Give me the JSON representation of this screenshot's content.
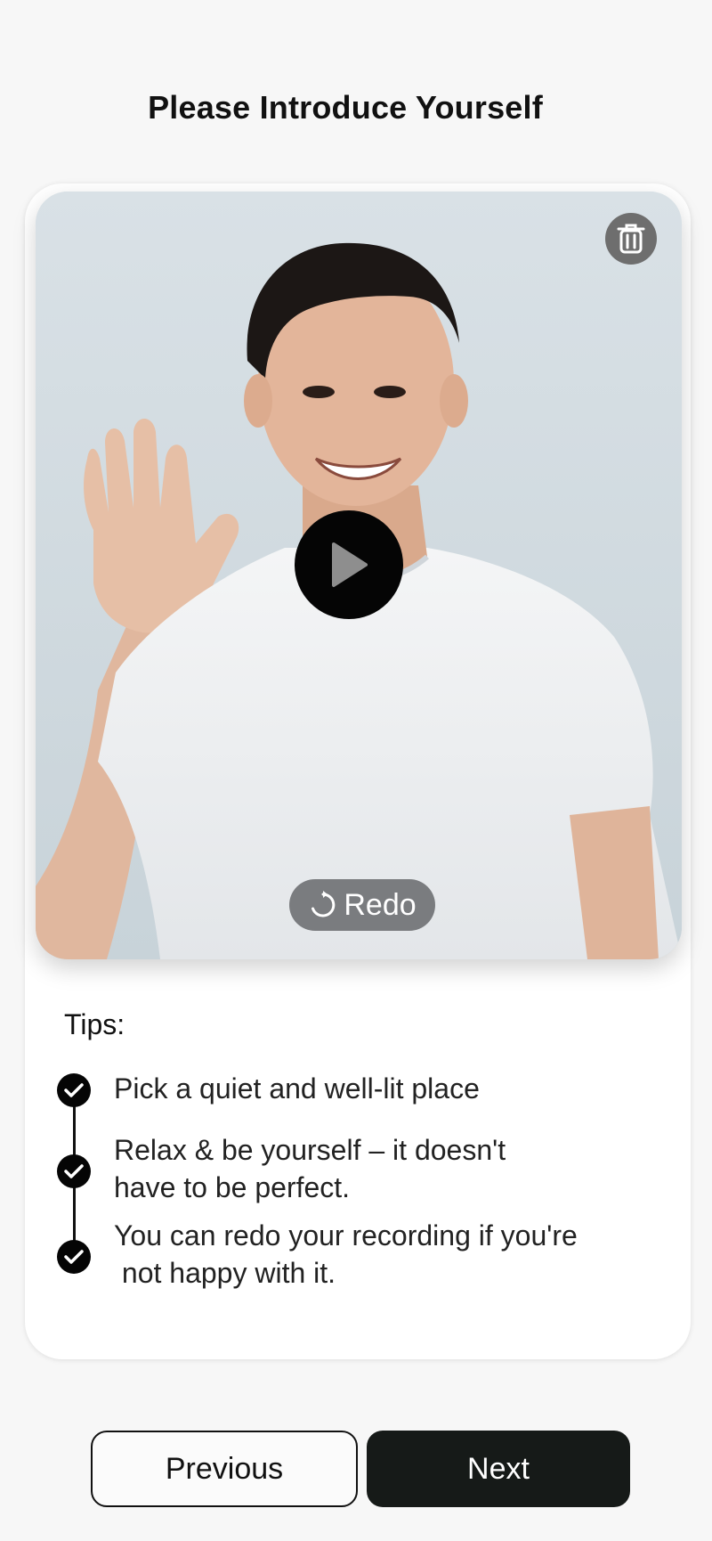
{
  "header": {
    "title": "Please Introduce Yourself"
  },
  "video": {
    "photo_description_icon": "person-waving-photo",
    "delete_icon": "trash-icon",
    "play_icon": "play-icon",
    "redo": {
      "label": "Redo",
      "icon": "rotate-icon"
    }
  },
  "tips": {
    "heading": "Tips:",
    "items": [
      {
        "lines": [
          "Pick a quiet and well-lit place"
        ]
      },
      {
        "lines": [
          "Relax & be yourself – it doesn't",
          "have to be perfect."
        ]
      },
      {
        "lines": [
          "You can redo your recording if you're",
          " not happy with it."
        ]
      }
    ]
  },
  "footer": {
    "previous_label": "Previous",
    "next_label": "Next"
  },
  "colors": {
    "accent_dark": "#161a18",
    "background": "#f7f7f7"
  }
}
